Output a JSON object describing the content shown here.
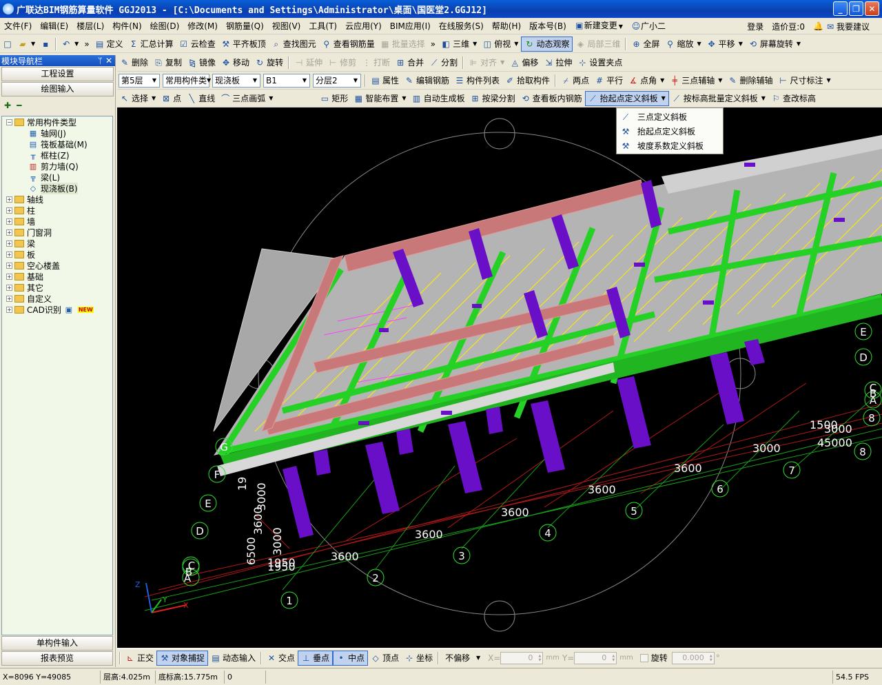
{
  "window": {
    "title": "广联达BIM钢筋算量软件 GGJ2013 - [C:\\Documents and Settings\\Administrator\\桌面\\国医堂2.GGJ12]",
    "minimize": "_",
    "restore": "❐",
    "close": "✕"
  },
  "menu": {
    "items": [
      "文件(F)",
      "编辑(E)",
      "楼层(L)",
      "构件(N)",
      "绘图(D)",
      "修改(M)",
      "钢筋量(Q)",
      "视图(V)",
      "工具(T)",
      "云应用(Y)",
      "BIM应用(I)",
      "在线服务(S)",
      "帮助(H)",
      "版本号(B)"
    ],
    "new_change": "新建变更",
    "assistant": "广小二",
    "login": "登录",
    "cost_beans": "造价豆:0",
    "suggest": "我要建议"
  },
  "toolbar1": {
    "define": "定义",
    "sum_calc": "汇总计算",
    "cloud_check": "云检查",
    "flush_slab_top": "平齐板顶",
    "find_element": "查找图元",
    "view_rebar_qty": "查看钢筋量",
    "batch_select": "批量选择",
    "view_3d": "三维",
    "view_plan": "俯视",
    "dynamic_observe": "动态观察",
    "local_3d": "局部三维",
    "full_screen": "全屏",
    "zoom": "缩放",
    "pan": "平移",
    "screen_rotate": "屏幕旋转"
  },
  "toolbar2": {
    "delete": "删除",
    "copy": "复制",
    "mirror": "镜像",
    "move": "移动",
    "rotate": "旋转",
    "extend": "延伸",
    "trim": "修剪",
    "break": "打断",
    "merge": "合并",
    "split": "分割",
    "align": "对齐",
    "offset": "偏移",
    "stretch": "拉伸",
    "grip_points": "设置夹点"
  },
  "toolbar3": {
    "floor": "第5层",
    "component_type": "常用构件类",
    "component": "现浇板",
    "name": "B1",
    "layer": "分层2",
    "property": "属性",
    "edit_rebar": "编辑钢筋",
    "component_list": "构件列表",
    "pick_component": "拾取构件",
    "two_points": "两点",
    "parallel": "平行",
    "point_angle": "点角",
    "three_point_aux": "三点辅轴",
    "delete_aux": "删除辅轴",
    "dimension": "尺寸标注"
  },
  "toolbar4": {
    "select": "选择",
    "point": "点",
    "line": "直线",
    "three_point_arc": "三点画弧",
    "rectangle": "矩形",
    "smart_place": "智能布置",
    "auto_generate": "自动生成板",
    "split_by_beam": "按梁分割",
    "view_slab_rebar": "查看板内钢筋",
    "raise_point_slope": "抬起点定义斜板",
    "batch_slope_by_elev": "按标高批量定义斜板",
    "modify_elev": "查改标高"
  },
  "dropdown": {
    "items": [
      "三点定义斜板",
      "抬起点定义斜板",
      "坡度系数定义斜板"
    ]
  },
  "left_panel": {
    "title": "模块导航栏",
    "pin": "ᛘ",
    "close": "✕",
    "project_settings": "工程设置",
    "drawing_input": "绘图输入",
    "tree": {
      "root": "常用构件类型",
      "children": [
        "轴网(J)",
        "筏板基础(M)",
        "框柱(Z)",
        "剪力墙(Q)",
        "梁(L)",
        "现浇板(B)"
      ],
      "groups": [
        "轴线",
        "柱",
        "墙",
        "门窗洞",
        "梁",
        "板",
        "空心楼盖",
        "基础",
        "其它",
        "自定义",
        "CAD识别"
      ],
      "new_badge": "NEW"
    },
    "single_input": "单构件输入",
    "report_preview": "报表预览"
  },
  "viewport": {
    "axis_labels_num": [
      "1",
      "2",
      "3",
      "4",
      "5",
      "6",
      "7",
      "8",
      "8"
    ],
    "axis_labels_alpha": [
      "A",
      "B",
      "C",
      "D",
      "E",
      "F",
      "G",
      "E",
      "D",
      "C",
      "B",
      "A"
    ],
    "dimensions": [
      "3600",
      "3600",
      "3600",
      "3600",
      "3600",
      "3000",
      "1500",
      "3000",
      "45000",
      "3000",
      "3600",
      "3000",
      "1950",
      "1950",
      "6500",
      "19"
    ],
    "axis_x": "X",
    "axis_y": "Y",
    "axis_z": "Z"
  },
  "snapbar": {
    "ortho": "正交",
    "object_snap": "对象捕捉",
    "dynamic_input": "动态输入",
    "intersection": "交点",
    "perpendicular": "垂点",
    "midpoint": "中点",
    "vertex": "顶点",
    "coordinate": "坐标",
    "offset_mode": "不偏移",
    "x_label": "X=",
    "x_value": "0",
    "y_label": "Y=",
    "y_value": "0",
    "unit": "mm",
    "rotate_label": "旋转",
    "rotate_value": "0.000",
    "degree": "°"
  },
  "status": {
    "coords": "X=8096 Y=49085",
    "floor_height": "层高:4.025m",
    "bottom_elev": "底标高:15.775m",
    "zero": "0",
    "fps": "54.5 FPS"
  },
  "colors": {
    "titlebar": "#0a47c4",
    "viewport_bg": "#000000",
    "beam_green": "#26d126",
    "column_purple": "#6a0fc8",
    "beam_pink": "#c87878",
    "slab_gray": "#b4b4b4",
    "rebar_yellow": "#ffff00"
  }
}
